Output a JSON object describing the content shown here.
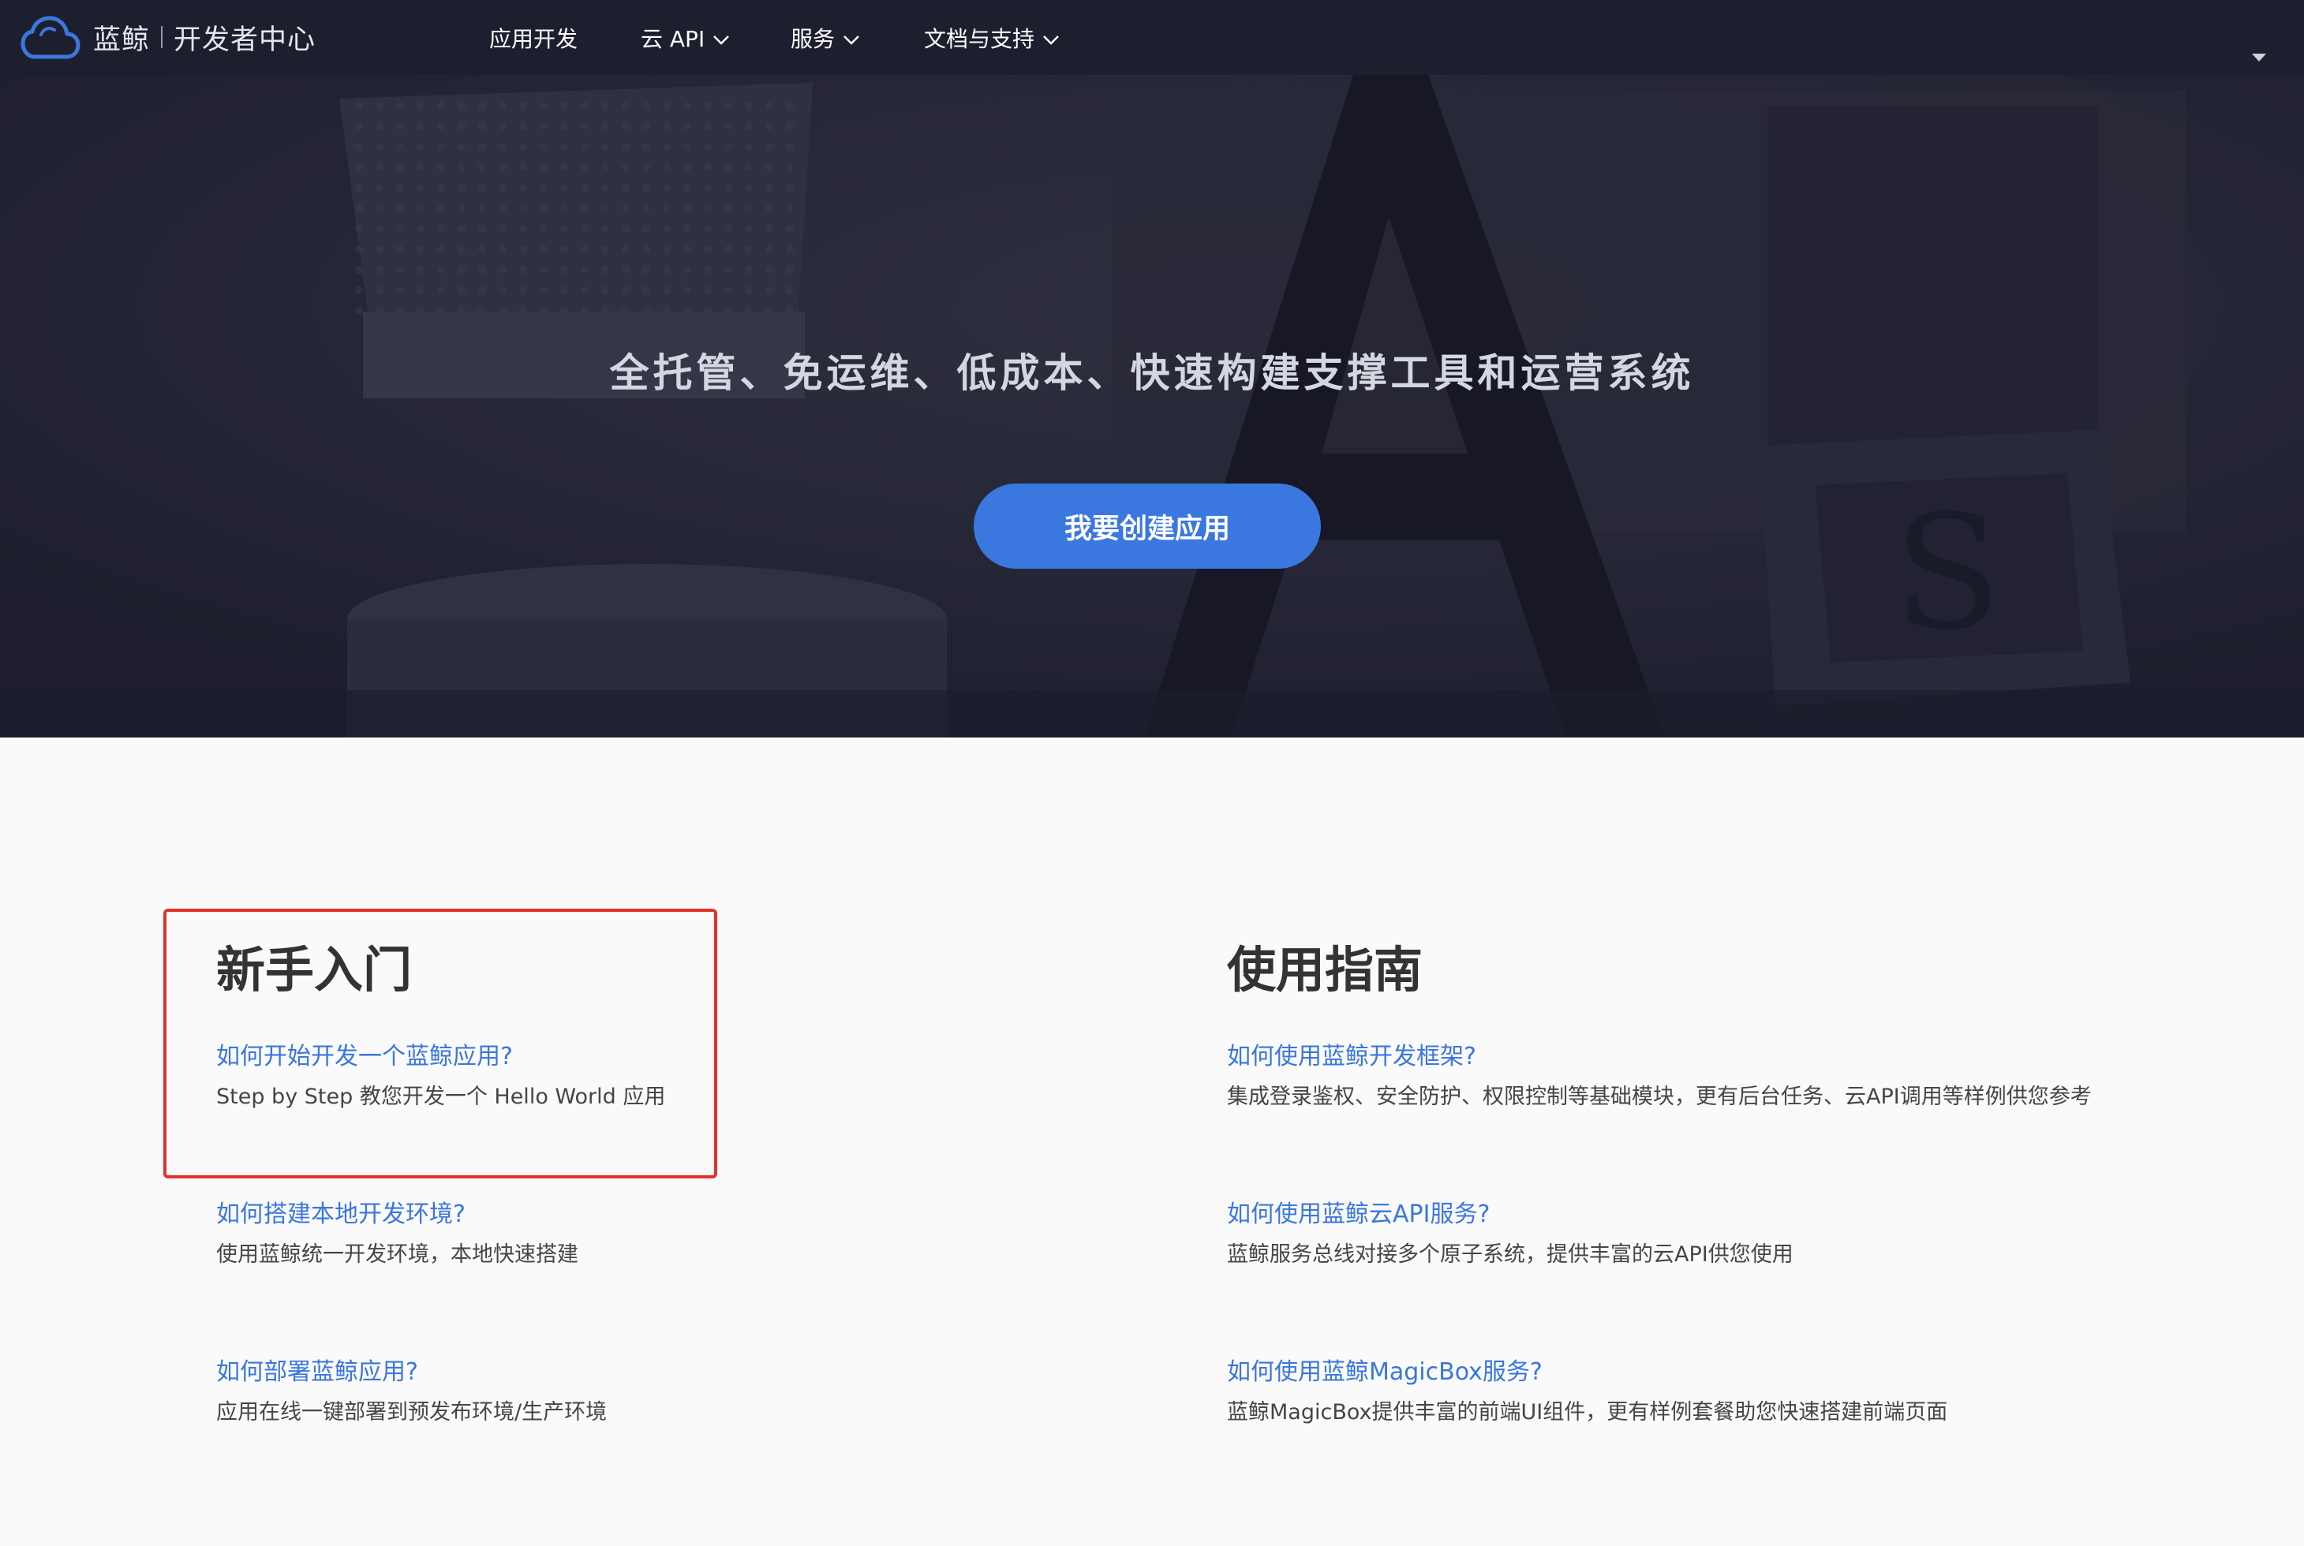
{
  "brand": {
    "name": "蓝鲸",
    "product": "开发者中心"
  },
  "nav": {
    "items": [
      {
        "label": "应用开发",
        "has_dropdown": false
      },
      {
        "label": "云 API",
        "has_dropdown": true
      },
      {
        "label": "服务",
        "has_dropdown": true
      },
      {
        "label": "文档与支持",
        "has_dropdown": true
      }
    ]
  },
  "hero": {
    "slogan": "全托管、免运维、低成本、快速构建支撑工具和运营系统",
    "cta_label": "我要创建应用"
  },
  "sections": {
    "getting_started": {
      "title": "新手入门",
      "items": [
        {
          "link": "如何开始开发一个蓝鲸应用?",
          "desc": "Step by Step 教您开发一个 Hello World 应用"
        },
        {
          "link": "如何搭建本地开发环境?",
          "desc": "使用蓝鲸统一开发环境，本地快速搭建"
        },
        {
          "link": "如何部署蓝鲸应用?",
          "desc": "应用在线一键部署到预发布环境/生产环境"
        }
      ]
    },
    "guide": {
      "title": "使用指南",
      "items": [
        {
          "link": "如何使用蓝鲸开发框架?",
          "desc": "集成登录鉴权、安全防护、权限控制等基础模块，更有后台任务、云API调用等样例供您参考"
        },
        {
          "link": "如何使用蓝鲸云API服务?",
          "desc": "蓝鲸服务总线对接多个原子系统，提供丰富的云API供您使用"
        },
        {
          "link": "如何使用蓝鲸MagicBox服务?",
          "desc": "蓝鲸MagicBox提供丰富的前端UI组件，更有样例套餐助您快速搭建前端页面"
        }
      ]
    }
  },
  "colors": {
    "nav_bg": "#1e1f2e",
    "accent": "#3a78e0",
    "link": "#3a76dd",
    "highlight": "#e0332c"
  },
  "icons": {
    "logo": "cloud-logo-icon",
    "dropdown": "chevron-down-icon",
    "user_menu": "caret-down-icon"
  }
}
